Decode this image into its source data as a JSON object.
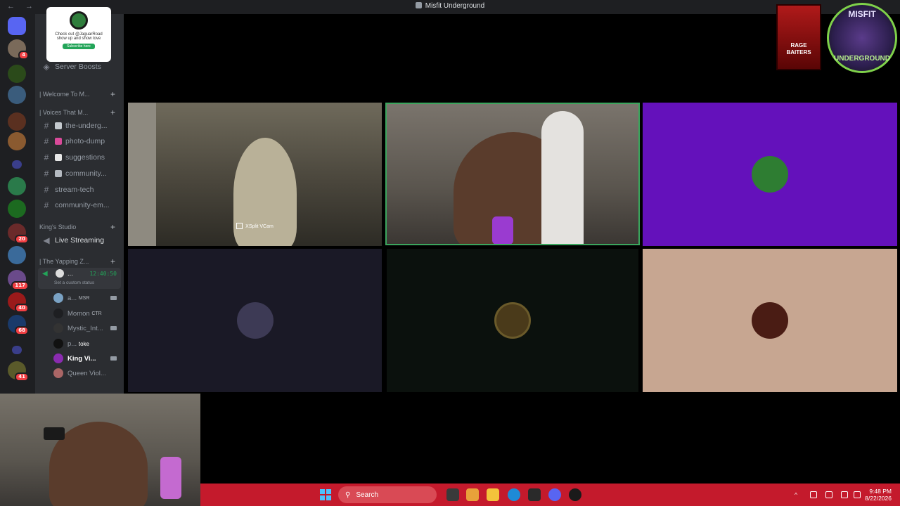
{
  "window": {
    "title": "Misfit Underground",
    "nav": "← →"
  },
  "promo": {
    "line1": "Check out @JaguarRoad",
    "line2": "show up and show love",
    "button": "Subscribe here"
  },
  "sidebar": {
    "server_boosts": "Server Boosts",
    "categories": {
      "welcome": "| Welcome To M...",
      "voices": "| Voices That M...",
      "kings_studio": "King's Studio",
      "yapping": "| The Yapping Z..."
    },
    "channels": [
      {
        "name": "the-underg...",
        "color": "#c4c9ce"
      },
      {
        "name": "photo-dump",
        "color": "#d94a9a"
      },
      {
        "name": "suggestions",
        "color": "#e8e8e8"
      },
      {
        "name": "community...",
        "color": "#b5bac1"
      },
      {
        "name": "stream-tech",
        "color": ""
      },
      {
        "name": "community-em...",
        "color": ""
      }
    ],
    "live_streaming": "Live Streaming",
    "self_user": {
      "name": "...",
      "timer": "12:40:50",
      "status": "Set a custom status"
    },
    "voice_users": [
      {
        "name": "a...",
        "tag": "MSR",
        "color": "#7aa2c4"
      },
      {
        "name": "Momon",
        "tag": "CTR",
        "color": "#6a3ab0"
      },
      {
        "name": "Mystic_Int...",
        "tag": "",
        "color": "#333"
      },
      {
        "name": "p...",
        "tag": "toke",
        "color": "#111"
      },
      {
        "name": "King Vi...",
        "tag": "",
        "color": "#8a2bb0"
      },
      {
        "name": "Queen Viol...",
        "tag": "",
        "color": "#a66"
      }
    ],
    "server_badges": [
      "4",
      "20",
      "117",
      "40",
      "68",
      "41"
    ]
  },
  "stage": {
    "tile1_label": "XSplit VCam",
    "tiles": [
      {
        "bg": "#6411bb",
        "avatar": "#2e7d32"
      },
      {
        "bg": "#1a1926",
        "avatar": "#3d3a55"
      },
      {
        "bg": "#0b110d",
        "avatar": "#4a3a1a"
      },
      {
        "bg": "#c7a691",
        "avatar": "#4a1c14"
      }
    ]
  },
  "logos": {
    "rage": "RAGE BAITERS",
    "misfit_top": "MISFIT",
    "misfit_bottom": "UNDERGROUND"
  },
  "taskbar": {
    "search": "Search",
    "time": "9:48 PM",
    "date": "8/22/2026",
    "accent": "#c41a2c"
  }
}
